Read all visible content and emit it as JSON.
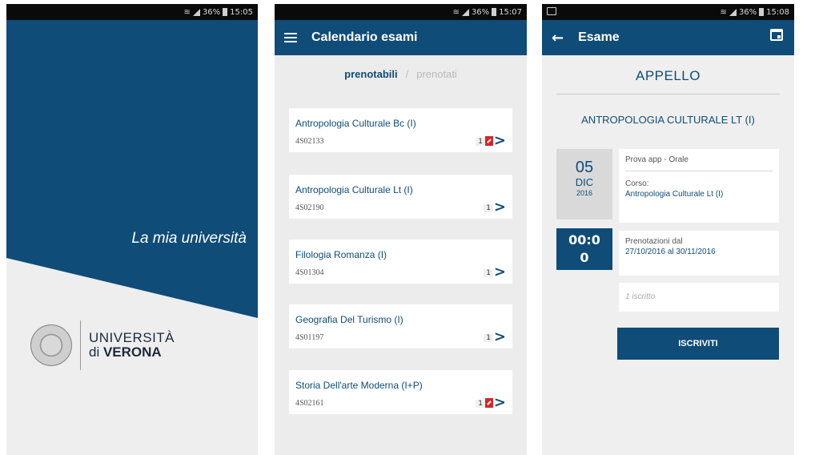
{
  "screens": {
    "splash": {
      "status_time": "15:05",
      "status_battery": "36%",
      "tagline": "La mia università",
      "logo_line1": "UNIVERSITÀ",
      "logo_line2_prefix": "di",
      "logo_line2_bold": "VERONA"
    },
    "calendar": {
      "status_time": "15:07",
      "status_battery": "36%",
      "title": "Calendario esami",
      "tabs": {
        "active": "prenotabili",
        "separator": "/",
        "inactive": "prenotati"
      },
      "items": [
        {
          "name": "Antropologia Culturale Bc (I)",
          "code": "4S02133",
          "count": "1",
          "has_flag": true
        },
        {
          "name": "Antropologia Culturale Lt (I)",
          "code": "4S02190",
          "count": "1",
          "has_flag": false
        },
        {
          "name": "Filologia Romanza (I)",
          "code": "4S01304",
          "count": "1",
          "has_flag": false
        },
        {
          "name": "Geografia Del Turismo (I)",
          "code": "4S01197",
          "count": "1",
          "has_flag": false
        },
        {
          "name": "Storia Dell'arte Moderna (I+P)",
          "code": "4S02161",
          "count": "1",
          "has_flag": true
        }
      ]
    },
    "detail": {
      "status_time": "15:08",
      "status_battery": "36%",
      "title": "Esame",
      "heading": "APPELLO",
      "exam_name": "ANTROPOLOGIA CULTURALE LT (I)",
      "date_day": "05",
      "date_month": "DIC",
      "date_year": "2016",
      "time": "00:00",
      "prova": "Prova app - Orale",
      "corso_label": "Corso:",
      "corso_value": "Antropologia Culturale Lt (I)",
      "prenotazioni_label": "Prenotazioni dal",
      "prenotazioni_value": "27/10/2016 al 30/11/2016",
      "iscritti": "1 iscritto",
      "button": "ISCRIVITI"
    }
  },
  "colors": {
    "primary": "#0f4c78",
    "accent_red": "#d8232a",
    "background": "#ececec"
  }
}
